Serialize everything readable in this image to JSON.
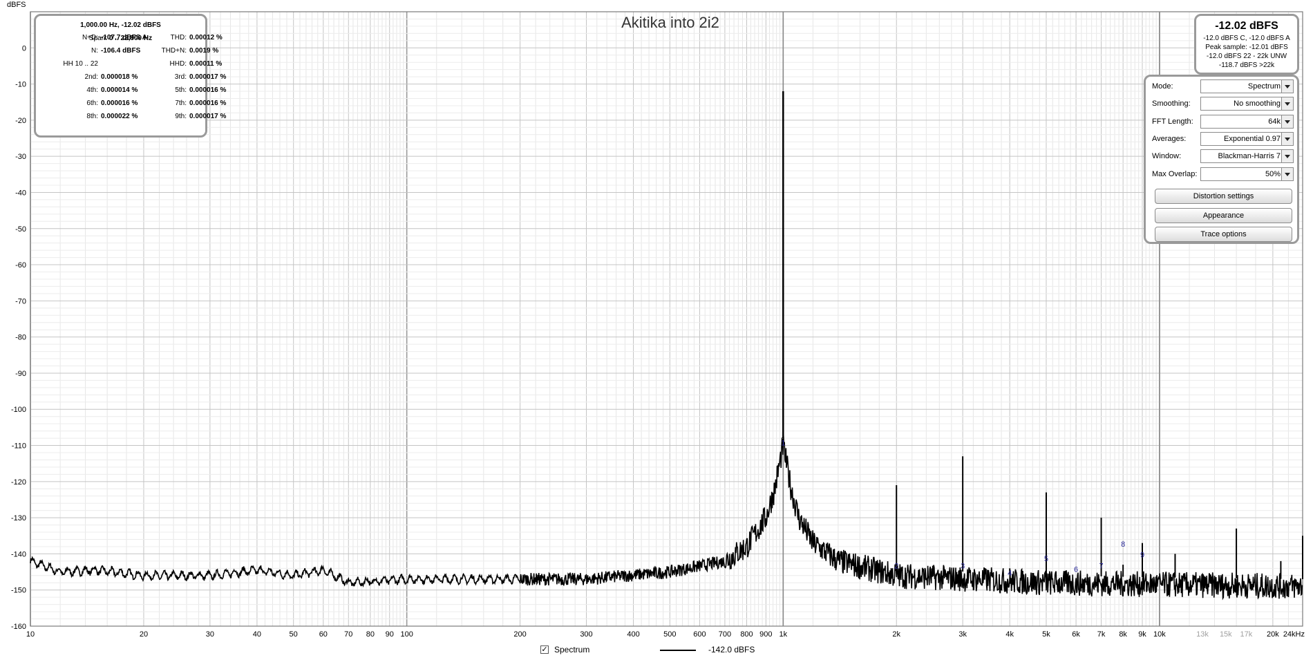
{
  "chart_data": {
    "type": "line",
    "title": "Akitika into 2i2",
    "ylabel": "dBFS",
    "x_axis": "log",
    "xlim": [
      10,
      24000
    ],
    "ylim": [
      -160,
      10
    ],
    "grid": true,
    "y_ticks": [
      0,
      -10,
      -20,
      -30,
      -40,
      -50,
      -60,
      -70,
      -80,
      -90,
      -100,
      -110,
      -120,
      -130,
      -140,
      -150,
      -160
    ],
    "x_ticks": [
      {
        "value": 10,
        "label": "10"
      },
      {
        "value": 20,
        "label": "20"
      },
      {
        "value": 30,
        "label": "30"
      },
      {
        "value": 40,
        "label": "40"
      },
      {
        "value": 50,
        "label": "50"
      },
      {
        "value": 60,
        "label": "60"
      },
      {
        "value": 70,
        "label": "70"
      },
      {
        "value": 80,
        "label": "80"
      },
      {
        "value": 90,
        "label": "90"
      },
      {
        "value": 100,
        "label": "100"
      },
      {
        "value": 200,
        "label": "200"
      },
      {
        "value": 300,
        "label": "300"
      },
      {
        "value": 400,
        "label": "400"
      },
      {
        "value": 500,
        "label": "500"
      },
      {
        "value": 600,
        "label": "600"
      },
      {
        "value": 700,
        "label": "700"
      },
      {
        "value": 800,
        "label": "800"
      },
      {
        "value": 900,
        "label": "900"
      },
      {
        "value": 1000,
        "label": "1k"
      },
      {
        "value": 2000,
        "label": "2k"
      },
      {
        "value": 3000,
        "label": "3k"
      },
      {
        "value": 4000,
        "label": "4k"
      },
      {
        "value": 5000,
        "label": "5k"
      },
      {
        "value": 6000,
        "label": "6k"
      },
      {
        "value": 7000,
        "label": "7k"
      },
      {
        "value": 8000,
        "label": "8k"
      },
      {
        "value": 9000,
        "label": "9k"
      },
      {
        "value": 10000,
        "label": "10k"
      },
      {
        "value": 13000,
        "label": "13k",
        "dim": true
      },
      {
        "value": 15000,
        "label": "15k",
        "dim": true
      },
      {
        "value": 17000,
        "label": "17k",
        "dim": true
      },
      {
        "value": 20000,
        "label": "20k"
      },
      {
        "value": 24000,
        "label": "24kHz"
      }
    ],
    "series": [
      {
        "name": "Spectrum",
        "color": "#000000",
        "noise_floor": [
          [
            10,
            -142
          ],
          [
            12,
            -145
          ],
          [
            15,
            -144.5
          ],
          [
            20,
            -146
          ],
          [
            30,
            -146
          ],
          [
            40,
            -144.5
          ],
          [
            50,
            -146
          ],
          [
            60,
            -144.5
          ],
          [
            70,
            -148
          ],
          [
            100,
            -147
          ],
          [
            200,
            -147
          ],
          [
            300,
            -147
          ],
          [
            500,
            -145
          ],
          [
            700,
            -142
          ],
          [
            800,
            -138
          ],
          [
            900,
            -130
          ],
          [
            950,
            -122
          ],
          [
            1000,
            -110
          ],
          [
            1050,
            -122
          ],
          [
            1100,
            -130
          ],
          [
            1200,
            -137
          ],
          [
            1400,
            -142
          ],
          [
            2000,
            -146
          ],
          [
            5000,
            -148
          ],
          [
            10000,
            -148.5
          ],
          [
            24000,
            -149
          ]
        ],
        "peaks": [
          {
            "freq": 1000,
            "db": -12
          },
          {
            "freq": 2000,
            "db": -121
          },
          {
            "freq": 3000,
            "db": -113
          },
          {
            "freq": 4000,
            "db": -144
          },
          {
            "freq": 5000,
            "db": -123
          },
          {
            "freq": 7000,
            "db": -130
          },
          {
            "freq": 8000,
            "db": -143
          },
          {
            "freq": 9000,
            "db": -137
          },
          {
            "freq": 11000,
            "db": -140
          },
          {
            "freq": 16000,
            "db": -133
          },
          {
            "freq": 21000,
            "db": -142
          },
          {
            "freq": 24000,
            "db": -135
          }
        ]
      }
    ],
    "harmonic_markers": [
      {
        "label": "1",
        "freq": 1000,
        "db": -110
      },
      {
        "label": "2",
        "freq": 2000,
        "db": -144
      },
      {
        "label": "3",
        "freq": 3000,
        "db": -144
      },
      {
        "label": "4",
        "freq": 4000,
        "db": -146
      },
      {
        "label": "5",
        "freq": 5000,
        "db": -142
      },
      {
        "label": "6",
        "freq": 6000,
        "db": -145
      },
      {
        "label": "7",
        "freq": 7000,
        "db": -144
      },
      {
        "label": "8",
        "freq": 8000,
        "db": -138
      },
      {
        "label": "9",
        "freq": 9000,
        "db": -141
      }
    ]
  },
  "stats": {
    "line1": "1,000.00 Hz, -12.02 dBFS",
    "span_label": "Span:",
    "span_value": "0 .. 22,800 Hz",
    "rows": [
      {
        "l_label": "N+D:",
        "l_value": "-107.7 dBFS A",
        "r_label": "THD:",
        "r_value": "0.00012 %"
      },
      {
        "l_label": "N:",
        "l_value": "-106.4 dBFS",
        "r_label": "THD+N:",
        "r_value": "0.0019 %"
      },
      {
        "l_label": "HH 10 .. 22",
        "l_value": "",
        "r_label": "HHD:",
        "r_value": "0.00011 %"
      },
      {
        "l_label": "2nd:",
        "l_value": "0.000018 %",
        "r_label": "3rd:",
        "r_value": "0.000017 %"
      },
      {
        "l_label": "4th:",
        "l_value": "0.000014 %",
        "r_label": "5th:",
        "r_value": "0.000016 %"
      },
      {
        "l_label": "6th:",
        "l_value": "0.000016 %",
        "r_label": "7th:",
        "r_value": "0.000016 %"
      },
      {
        "l_label": "8th:",
        "l_value": "0.000022 %",
        "r_label": "9th:",
        "r_value": "0.000017 %"
      }
    ]
  },
  "level": {
    "main": "-12.02 dBFS",
    "lines": [
      "-12.0 dBFS C, -12.0 dBFS A",
      "Peak sample: -12.01 dBFS",
      "-12.0 dBFS 22 - 22k UNW",
      "-118.7 dBFS >22k"
    ]
  },
  "controls": {
    "rows": [
      {
        "label": "Mode:",
        "value": "Spectrum"
      },
      {
        "label": "Smoothing:",
        "value": "No  smoothing"
      },
      {
        "label": "FFT Length:",
        "value": "64k"
      },
      {
        "label": "Averages:",
        "value": "Exponential 0.97"
      },
      {
        "label": "Window:",
        "value": "Blackman-Harris 7"
      },
      {
        "label": "Max Overlap:",
        "value": "50%"
      }
    ],
    "buttons": [
      "Distortion settings",
      "Appearance",
      "Trace options"
    ]
  },
  "legend": {
    "checked_glyph": "✓",
    "name": "Spectrum",
    "level": "-142.0 dBFS"
  }
}
